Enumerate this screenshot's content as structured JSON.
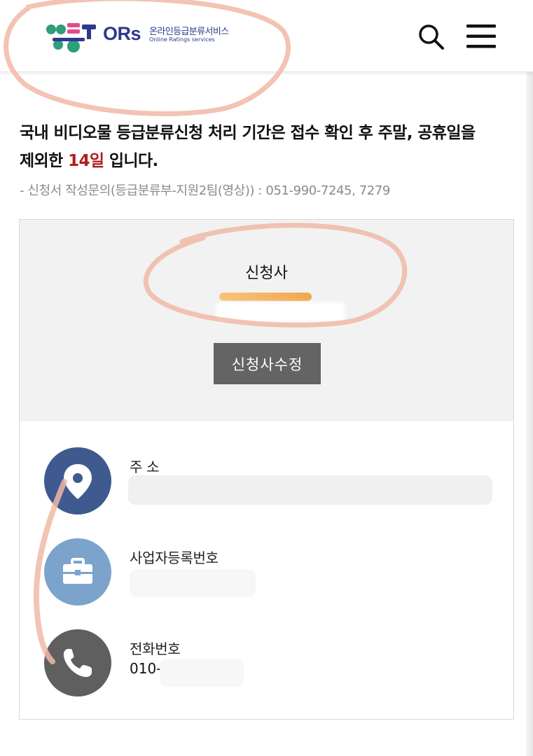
{
  "header": {
    "logo": {
      "wordmark": "ORs",
      "service_name_ko": "온라인등급분류서비스",
      "service_name_en": "Online Ratings services"
    },
    "search_icon": "search-icon",
    "menu_icon": "hamburger-menu-icon"
  },
  "notice": {
    "line1": "국내 비디오물 등급분류신청 처리 기간은 접수 확인 후 주말, 공휴일을",
    "line2_prefix": "제외한 ",
    "line2_highlight": "14일",
    "line2_suffix": " 입니다.",
    "highlight_color": "#b01e1e"
  },
  "contact": "- 신청서 작성문의(등급분류부-지원2팀(영상)) : 051-990-7245, 7279",
  "applicant": {
    "title": "신청사",
    "edit_button": "신청사수정"
  },
  "info": [
    {
      "label": "주 소",
      "value": "",
      "icon": "location-pin-icon",
      "color": "#3f5a8e"
    },
    {
      "label": "사업자등록번호",
      "value": "",
      "icon": "briefcase-icon",
      "color": "#7ba3cc"
    },
    {
      "label": "전화번호",
      "value": "010-",
      "icon": "phone-icon",
      "color": "#5f5f5f"
    }
  ]
}
